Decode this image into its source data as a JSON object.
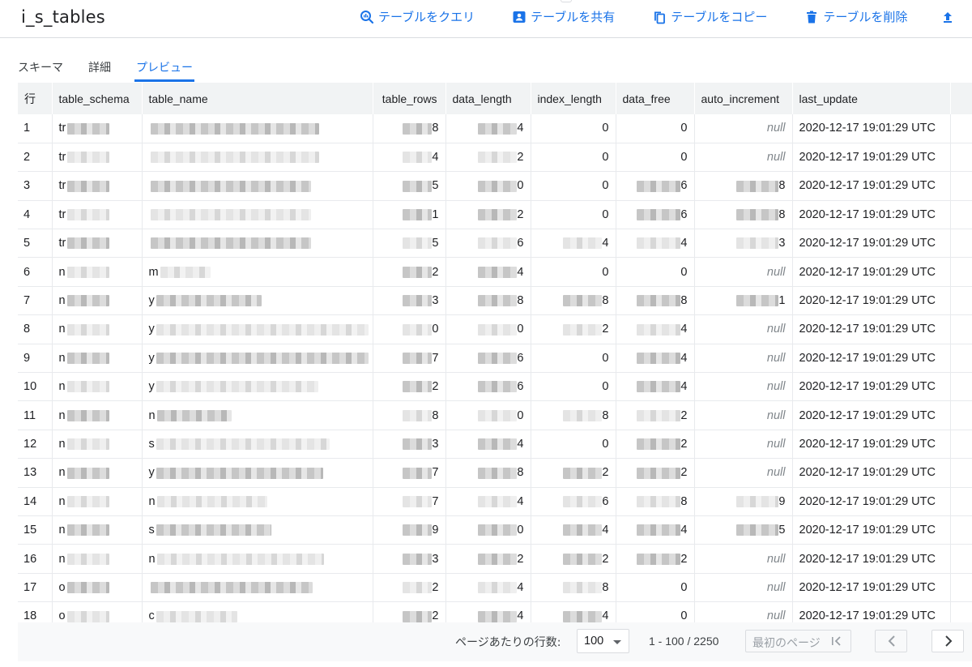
{
  "header": {
    "title": "i_s_tables",
    "actions": [
      {
        "label": "テーブルをクエリ",
        "icon": "query-search-icon"
      },
      {
        "label": "テーブルを共有",
        "icon": "share-person-icon"
      },
      {
        "label": "テーブルをコピー",
        "icon": "copy-icon"
      },
      {
        "label": "テーブルを削除",
        "icon": "trash-icon"
      }
    ]
  },
  "tabs": [
    {
      "label": "スキーマ",
      "active": false
    },
    {
      "label": "詳細",
      "active": false
    },
    {
      "label": "プレビュー",
      "active": true
    }
  ],
  "table": {
    "columns": [
      "行",
      "table_schema",
      "table_name",
      "table_rows",
      "data_length",
      "index_length",
      "data_free",
      "auto_increment",
      "last_update"
    ],
    "rows": [
      {
        "row": "1",
        "schema": "tr",
        "name": "",
        "table_rows": "8",
        "data_length": "4",
        "index_length": "0",
        "data_free": "0",
        "auto_increment": "null",
        "last_update": "2020-12-17 19:01:29 UTC"
      },
      {
        "row": "2",
        "schema": "tr",
        "name": "",
        "table_rows": "4",
        "data_length": "2",
        "index_length": "0",
        "data_free": "0",
        "auto_increment": "null",
        "last_update": "2020-12-17 19:01:29 UTC"
      },
      {
        "row": "3",
        "schema": "tr",
        "name": "",
        "table_rows": "5",
        "data_length": "0",
        "index_length": "0",
        "data_free": "6",
        "auto_increment": "8",
        "last_update": "2020-12-17 19:01:29 UTC"
      },
      {
        "row": "4",
        "schema": "tr",
        "name": "",
        "table_rows": "1",
        "data_length": "2",
        "index_length": "0",
        "data_free": "6",
        "auto_increment": "8",
        "last_update": "2020-12-17 19:01:29 UTC"
      },
      {
        "row": "5",
        "schema": "tr",
        "name": "",
        "table_rows": "5",
        "data_length": "6",
        "index_length": "4",
        "data_free": "4",
        "auto_increment": "3",
        "last_update": "2020-12-17 19:01:29 UTC"
      },
      {
        "row": "6",
        "schema": "n",
        "name": "m",
        "table_rows": "2",
        "data_length": "4",
        "index_length": "0",
        "data_free": "0",
        "auto_increment": "null",
        "last_update": "2020-12-17 19:01:29 UTC"
      },
      {
        "row": "7",
        "schema": "n",
        "name": "y",
        "table_rows": "3",
        "data_length": "8",
        "index_length": "8",
        "data_free": "8",
        "auto_increment": "1",
        "last_update": "2020-12-17 19:01:29 UTC"
      },
      {
        "row": "8",
        "schema": "n",
        "name": "y",
        "table_rows": "0",
        "data_length": "0",
        "index_length": "2",
        "data_free": "4",
        "auto_increment": "null",
        "last_update": "2020-12-17 19:01:29 UTC"
      },
      {
        "row": "9",
        "schema": "n",
        "name": "y",
        "table_rows": "7",
        "data_length": "6",
        "index_length": "0",
        "data_free": "4",
        "auto_increment": "null",
        "last_update": "2020-12-17 19:01:29 UTC"
      },
      {
        "row": "10",
        "schema": "n",
        "name": "y",
        "table_rows": "2",
        "data_length": "6",
        "index_length": "0",
        "data_free": "4",
        "auto_increment": "null",
        "last_update": "2020-12-17 19:01:29 UTC"
      },
      {
        "row": "11",
        "schema": "n",
        "name": "n",
        "table_rows": "8",
        "data_length": "0",
        "index_length": "8",
        "data_free": "2",
        "auto_increment": "null",
        "last_update": "2020-12-17 19:01:29 UTC"
      },
      {
        "row": "12",
        "schema": "n",
        "name": "s",
        "table_rows": "3",
        "data_length": "4",
        "index_length": "0",
        "data_free": "2",
        "auto_increment": "null",
        "last_update": "2020-12-17 19:01:29 UTC"
      },
      {
        "row": "13",
        "schema": "n",
        "name": "y",
        "table_rows": "7",
        "data_length": "8",
        "index_length": "2",
        "data_free": "2",
        "auto_increment": "null",
        "last_update": "2020-12-17 19:01:29 UTC"
      },
      {
        "row": "14",
        "schema": "n",
        "name": "n",
        "table_rows": "7",
        "data_length": "4",
        "index_length": "6",
        "data_free": "8",
        "auto_increment": "9",
        "last_update": "2020-12-17 19:01:29 UTC"
      },
      {
        "row": "15",
        "schema": "n",
        "name": "s",
        "table_rows": "9",
        "data_length": "0",
        "index_length": "4",
        "data_free": "4",
        "auto_increment": "5",
        "last_update": "2020-12-17 19:01:29 UTC"
      },
      {
        "row": "16",
        "schema": "n",
        "name": "n",
        "table_rows": "3",
        "data_length": "2",
        "index_length": "2",
        "data_free": "2",
        "auto_increment": "null",
        "last_update": "2020-12-17 19:01:29 UTC"
      },
      {
        "row": "17",
        "schema": "o",
        "name": "",
        "table_rows": "2",
        "data_length": "4",
        "index_length": "8",
        "data_free": "0",
        "auto_increment": "null",
        "last_update": "2020-12-17 19:01:29 UTC"
      },
      {
        "row": "18",
        "schema": "o",
        "name": "c",
        "table_rows": "2",
        "data_length": "4",
        "index_length": "4",
        "data_free": "0",
        "auto_increment": "null",
        "last_update": "2020-12-17 19:01:29 UTC"
      }
    ]
  },
  "pagination": {
    "rows_per_page_label": "ページあたりの行数:",
    "rows_per_page": "100",
    "range": "1 - 100 / 2250",
    "first_page_label": "最初のページ"
  },
  "colors": {
    "accent": "#1a73e8",
    "header_bg": "#f1f3f4",
    "null_text": "#80868b"
  }
}
